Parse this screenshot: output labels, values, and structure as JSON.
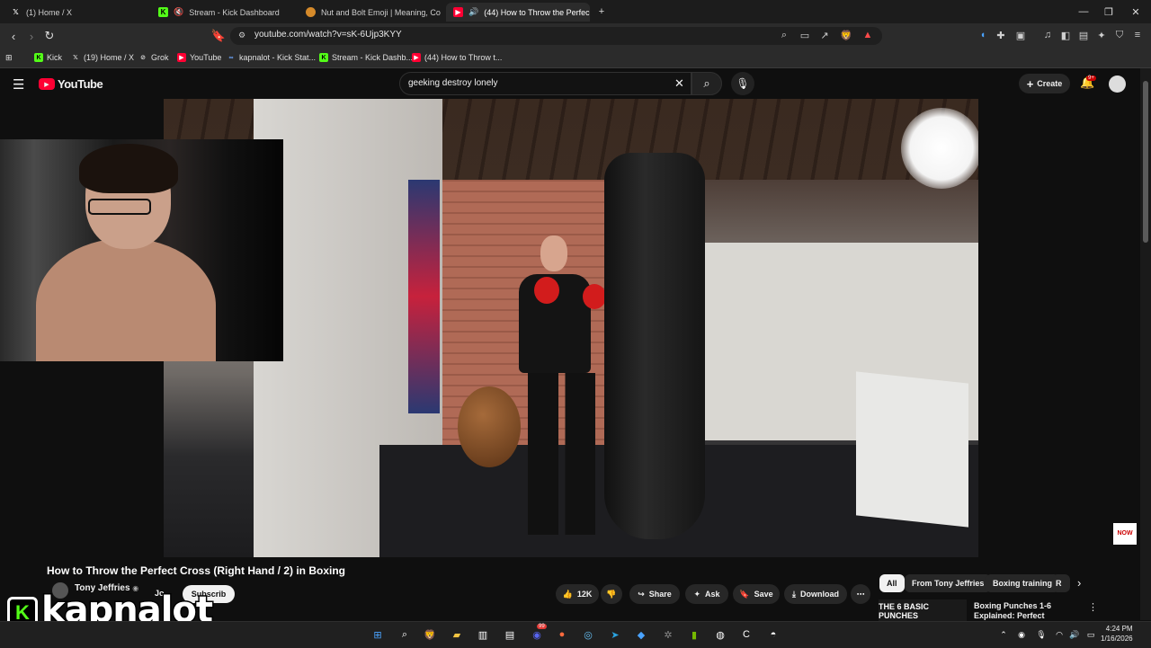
{
  "browser": {
    "tabs": [
      {
        "title": "(1) Home / X",
        "favicon": "x-logo-icon",
        "active": false
      },
      {
        "title": "Stream - Kick Dashboard",
        "favicon": "kick-logo-icon",
        "active": false
      },
      {
        "title": "Nut and Bolt Emoji | Meaning, Co",
        "favicon": "emoji-site-icon",
        "active": false
      },
      {
        "title": "(44) How to Throw the Perfec",
        "favicon": "youtube-icon",
        "active": true
      }
    ],
    "new_tab_symbol": "+",
    "url": "youtube.com/watch?v=sK-6Ujp3KYY",
    "bookmarks": [
      {
        "label": "Kick"
      },
      {
        "label": "(19) Home / X"
      },
      {
        "label": "Grok"
      },
      {
        "label": "YouTube"
      },
      {
        "label": "kapnalot - Kick Stat..."
      },
      {
        "label": "Stream - Kick Dashb..."
      },
      {
        "label": "(44) How to Throw t..."
      }
    ],
    "brave_badge": "9",
    "rewards_badge": "2"
  },
  "youtube": {
    "logo_text": "YouTube",
    "search_value": "geeking destroy lonely",
    "create_label": "Create",
    "notifications_badge": "9+",
    "video": {
      "title": "How to Throw the Perfect Cross (Right Hand / 2) in Boxing",
      "channel": "Tony Jeffries",
      "join_label": "Jo",
      "subscribe_label": "Subscrib",
      "likes": "12K",
      "share_label": "Share",
      "ask_label": "Ask",
      "save_label": "Save",
      "download_label": "Download",
      "overlay_badge": "NOW"
    },
    "chips": [
      "All",
      "From Tony Jeffries",
      "Boxing training",
      "R"
    ],
    "recommendation": {
      "thumb_text": "THE 6 BASIC PUNCHES",
      "title": "Boxing Punches 1-6 Explained: Perfect Techniques"
    }
  },
  "overlay": {
    "streamer_name": "kapnalot",
    "kick_logo_letter": "K",
    "accent": "#53fc18"
  },
  "taskbar": {
    "time": "4:24 PM",
    "date": "1/16/2026",
    "discord_badge": "99"
  }
}
